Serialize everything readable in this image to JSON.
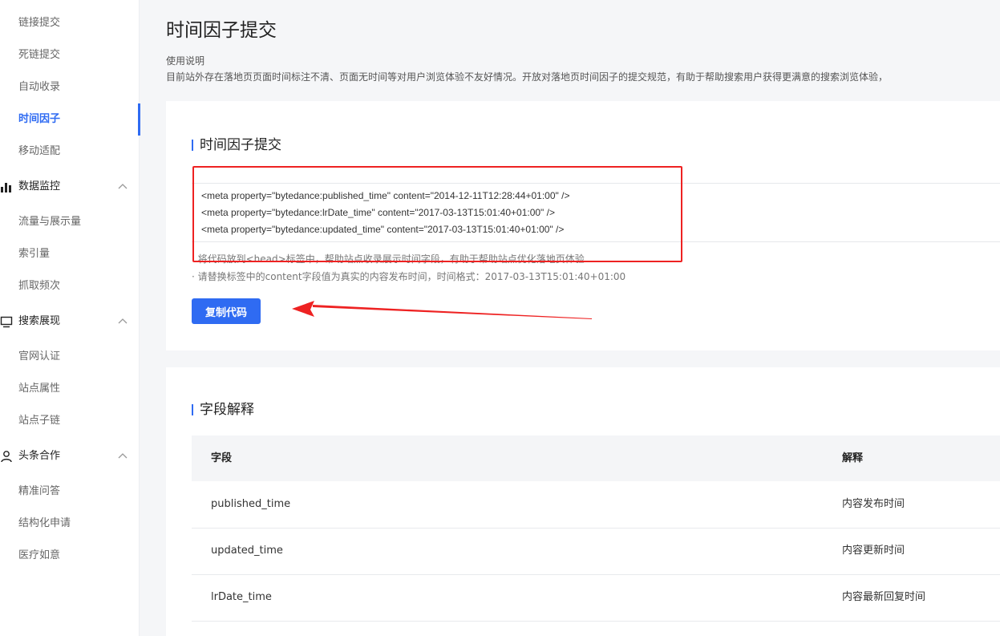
{
  "sidebar": {
    "items_top": [
      "链接提交",
      "死链提交",
      "自动收录",
      "时间因子",
      "移动适配"
    ],
    "active": "时间因子",
    "groups": [
      {
        "label": "数据监控",
        "icon": "bar-chart-icon",
        "items": [
          "流量与展示量",
          "索引量",
          "抓取频次"
        ]
      },
      {
        "label": "搜索展现",
        "icon": "monitor-icon",
        "items": [
          "官网认证",
          "站点属性",
          "站点子链"
        ]
      },
      {
        "label": "头条合作",
        "icon": "user-icon",
        "items": [
          "精准问答",
          "结构化申请",
          "医疗如意"
        ]
      }
    ]
  },
  "main": {
    "title": "时间因子提交",
    "help_title": "使用说明",
    "help_text": "目前站外存在落地页页面时间标注不清、页面无时间等对用户浏览体验不友好情况。开放对落地页时间因子的提交规范，有助于帮助搜索用户获得更满意的搜索浏览体验，",
    "submit": {
      "section_title": "时间因子提交",
      "code_lines": [
        "<meta property=\"bytedance:published_time\" content=\"2014-12-11T12:28:44+01:00\" />",
        "<meta property=\"bytedance:lrDate_time\" content=\"2017-03-13T15:01:40+01:00\" />",
        "<meta property=\"bytedance:updated_time\" content=\"2017-03-13T15:01:40+01:00\" />"
      ],
      "note1": "· 将代码放到<head>标签中，帮助站点收录展示时间字段，有助于帮助站点优化落地页体验",
      "note2": "· 请替换标签中的content字段值为真实的内容发布时间，时间格式：2017-03-13T15:01:40+01:00",
      "copy_button": "复制代码"
    },
    "fields": {
      "section_title": "字段解释",
      "headers": [
        "字段",
        "解释"
      ],
      "rows": [
        [
          "published_time",
          "内容发布时间"
        ],
        [
          "updated_time",
          "内容更新时间"
        ],
        [
          "lrDate_time",
          "内容最新回复时间"
        ]
      ]
    }
  },
  "colors": {
    "accent": "#2f6bf2",
    "annotation": "#ee2222",
    "background": "#f5f6f8"
  }
}
